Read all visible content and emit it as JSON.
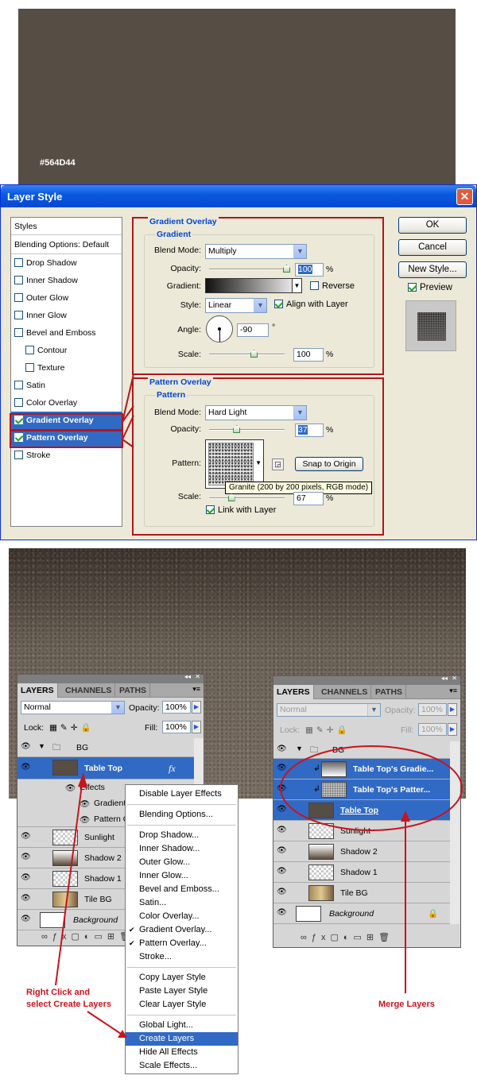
{
  "swatch": {
    "label": "#564D44",
    "color": "#564D44"
  },
  "dialog": {
    "title": "Layer Style",
    "styles_header": "Styles",
    "blending": "Blending Options: Default",
    "items": [
      {
        "label": "Drop Shadow",
        "checked": false
      },
      {
        "label": "Inner Shadow",
        "checked": false
      },
      {
        "label": "Outer Glow",
        "checked": false
      },
      {
        "label": "Inner Glow",
        "checked": false
      },
      {
        "label": "Bevel and Emboss",
        "checked": false
      },
      {
        "label": "Contour",
        "checked": false
      },
      {
        "label": "Texture",
        "checked": false
      },
      {
        "label": "Satin",
        "checked": false
      },
      {
        "label": "Color Overlay",
        "checked": false
      },
      {
        "label": "Gradient Overlay",
        "checked": true
      },
      {
        "label": "Pattern Overlay",
        "checked": true
      },
      {
        "label": "Stroke",
        "checked": false
      }
    ],
    "gradient": {
      "section": "Gradient Overlay",
      "group": "Gradient",
      "blend_label": "Blend Mode:",
      "blend": "Multiply",
      "opacity_label": "Opacity:",
      "opacity": "100",
      "opacity_pct": 0.98,
      "gradient_label": "Gradient:",
      "reverse": "Reverse",
      "style_label": "Style:",
      "style": "Linear",
      "align": "Align with Layer",
      "angle_label": "Angle:",
      "angle": "-90",
      "scale_label": "Scale:",
      "scale": "100",
      "scale_pct": 0.6,
      "pct": "%",
      "deg": "°"
    },
    "pattern": {
      "section": "Pattern Overlay",
      "group": "Pattern",
      "blend_label": "Blend Mode:",
      "blend": "Hard Light",
      "opacity_label": "Opacity:",
      "opacity": "37",
      "opacity_pct": 0.37,
      "pattern_label": "Pattern:",
      "snap": "Snap to Origin",
      "tooltip": "Granite (200 by 200 pixels, RGB mode)",
      "scale_label": "Scale:",
      "scale": "67",
      "scale_pct": 0.3,
      "link": "Link with Layer",
      "pct": "%"
    },
    "buttons": {
      "ok": "OK",
      "cancel": "Cancel",
      "new_style": "New Style...",
      "preview": "Preview"
    }
  },
  "layers_left": {
    "tabs": [
      "LAYERS",
      "CHANNELS",
      "PATHS"
    ],
    "blend": "Normal",
    "opacity_label": "Opacity:",
    "opacity": "100%",
    "lock_label": "Lock:",
    "fill_label": "Fill:",
    "fill": "100%",
    "group": "BG",
    "table_top": "Table Top",
    "fx": "fx",
    "effects": "Effects",
    "effect1": "Gradient",
    "effect2": "Pattern O",
    "sunlight": "Sunlight",
    "shadow2": "Shadow 2",
    "shadow1": "Shadow 1",
    "tile": "Tile BG",
    "background": "Background"
  },
  "layers_right": {
    "tabs": [
      "LAYERS",
      "CHANNELS",
      "PATHS"
    ],
    "blend": "Normal",
    "opacity_label": "Opacity:",
    "opacity": "100%",
    "lock_label": "Lock:",
    "fill_label": "Fill:",
    "fill": "100%",
    "group": "BG",
    "grad_layer": "Table Top's Gradie...",
    "pat_layer": "Table Top's Patter...",
    "table_top": "Table Top",
    "sunlight": "Sunlight",
    "shadow2": "Shadow 2",
    "shadow1": "Shadow 1",
    "tile": "Tile BG",
    "background": "Background"
  },
  "menu": [
    [
      "Disable Layer Effects"
    ],
    [
      "Blending Options..."
    ],
    [
      "Drop Shadow...",
      "Inner Shadow...",
      "Outer Glow...",
      "Inner Glow...",
      "Bevel and Emboss...",
      "Satin...",
      "Color Overlay...",
      "Gradient Overlay...",
      "Pattern Overlay...",
      "Stroke..."
    ],
    [
      "Copy Layer Style",
      "Paste Layer Style",
      "Clear Layer Style"
    ],
    [
      "Global Light...",
      "Create Layers",
      "Hide All Effects",
      "Scale Effects..."
    ]
  ],
  "menu_checked": [
    "Gradient Overlay...",
    "Pattern Overlay..."
  ],
  "menu_selected": "Create Layers",
  "annotations": {
    "left": "Right Click and\nselect Create Layers",
    "right": "Merge Layers"
  },
  "colors": {
    "accent": "#316ac5",
    "annotation": "#c8141e"
  }
}
